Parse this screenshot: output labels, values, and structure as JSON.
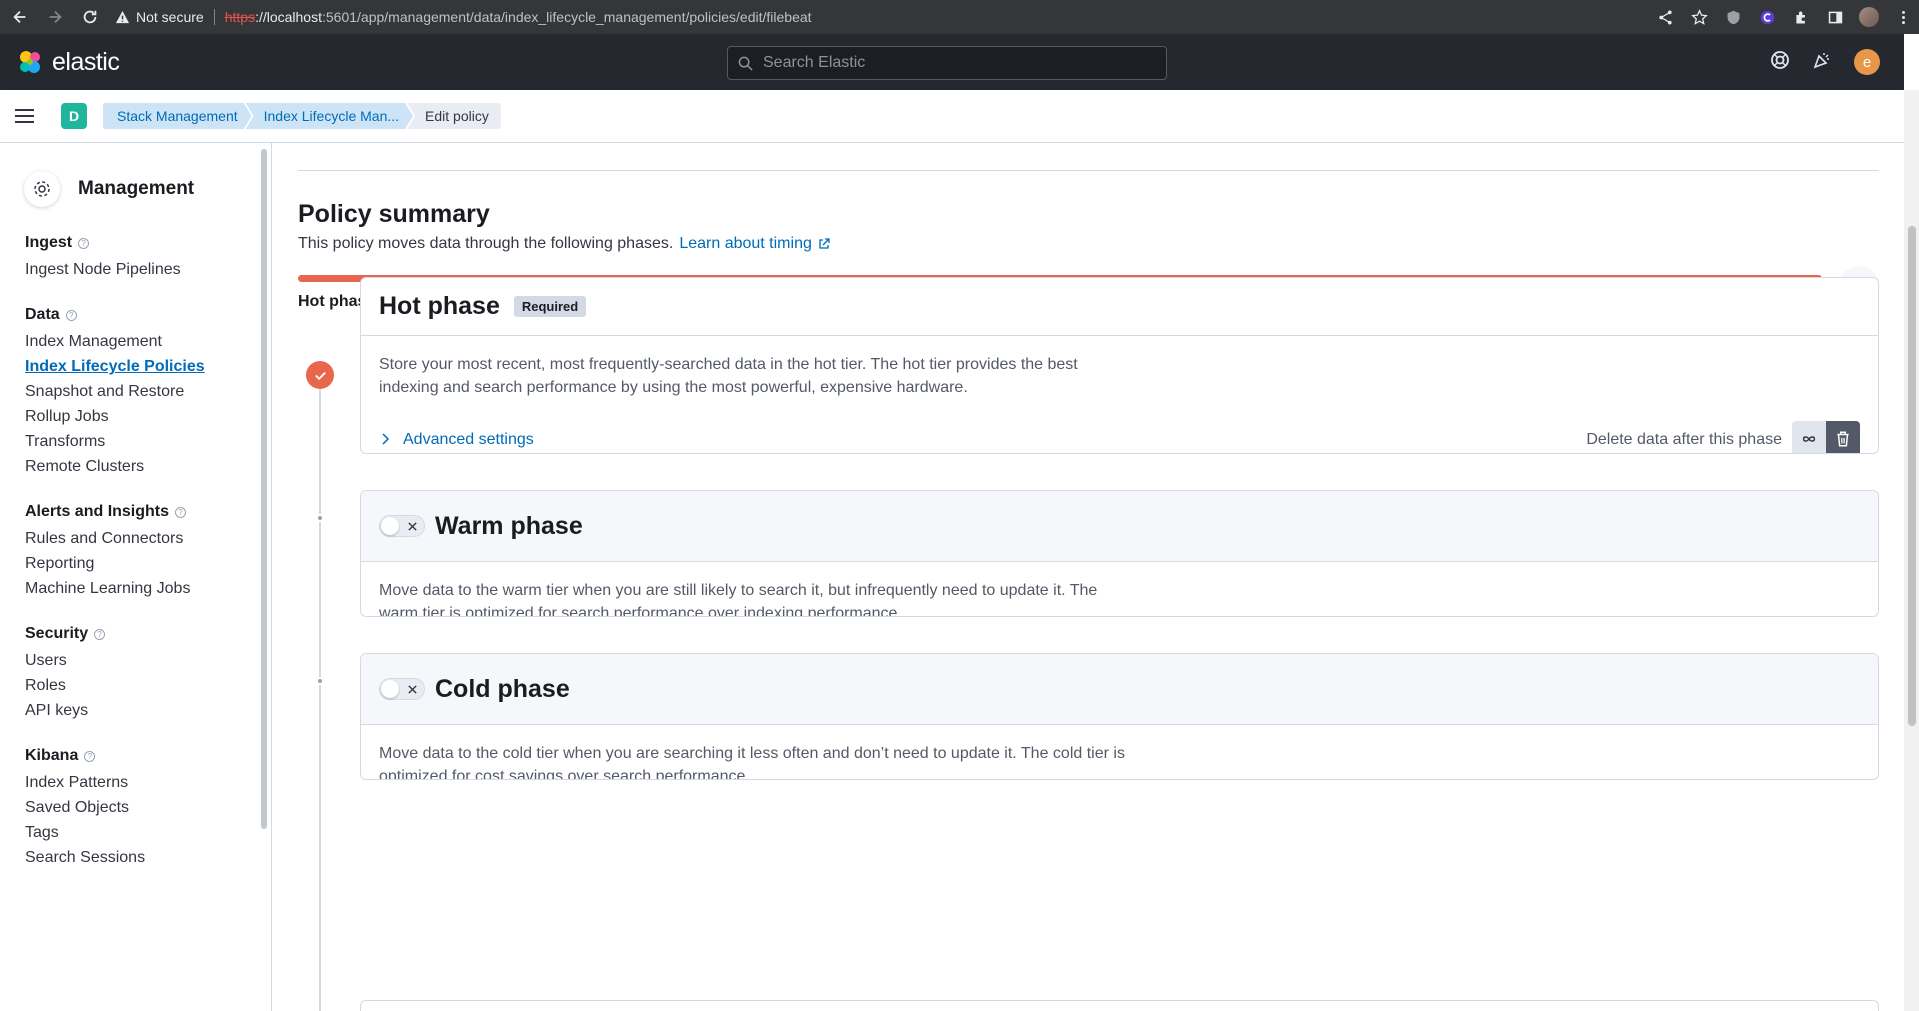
{
  "browser": {
    "security_label": "Not secure",
    "url_scheme": "https",
    "url_host": "://localhost",
    "url_rest": ":5601/app/management/data/index_lifecycle_management/policies/edit/filebeat"
  },
  "header": {
    "logo_text": "elastic",
    "search_placeholder": "Search Elastic",
    "user_initial": "e"
  },
  "breadcrumbs": {
    "space_initial": "D",
    "items": [
      "Stack Management",
      "Index Lifecycle Man...",
      "Edit policy"
    ]
  },
  "sidebar": {
    "title": "Management",
    "groups": [
      {
        "title": "Ingest",
        "items": [
          "Ingest Node Pipelines"
        ]
      },
      {
        "title": "Data",
        "items": [
          "Index Management",
          "Index Lifecycle Policies",
          "Snapshot and Restore",
          "Rollup Jobs",
          "Transforms",
          "Remote Clusters"
        ]
      },
      {
        "title": "Alerts and Insights",
        "items": [
          "Rules and Connectors",
          "Reporting",
          "Machine Learning Jobs"
        ]
      },
      {
        "title": "Security",
        "items": [
          "Users",
          "Roles",
          "API keys"
        ]
      },
      {
        "title": "Kibana",
        "items": [
          "Index Patterns",
          "Saved Objects",
          "Tags",
          "Search Sessions"
        ]
      }
    ],
    "active_item": "Index Lifecycle Policies"
  },
  "summary": {
    "title": "Policy summary",
    "description": "This policy moves data through the following phases.",
    "link": "Learn about timing",
    "timeline_label": "Hot phase",
    "timeline_color": "#e7664c"
  },
  "phases": {
    "hot": {
      "title": "Hot phase",
      "badge": "Required",
      "description": "Store your most recent, most frequently-searched data in the hot tier. The hot tier provides the best indexing and search performance by using the most powerful, expensive hardware.",
      "advanced": "Advanced settings",
      "delete_label": "Delete data after this phase"
    },
    "warm": {
      "title": "Warm phase",
      "enabled": false,
      "description": "Move data to the warm tier when you are still likely to search it, but infrequently need to update it. The warm tier is optimized for search performance over indexing performance."
    },
    "cold": {
      "title": "Cold phase",
      "enabled": false,
      "description": "Move data to the cold tier when you are searching it less often and don’t need to update it. The cold tier is optimized for cost savings over search performance."
    }
  }
}
